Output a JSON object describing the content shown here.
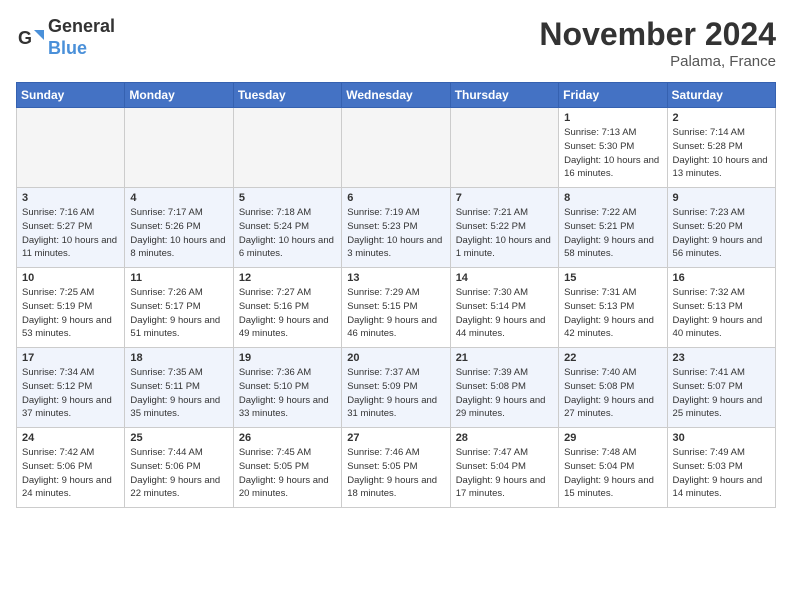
{
  "header": {
    "logo_line1": "General",
    "logo_line2": "Blue",
    "month": "November 2024",
    "location": "Palama, France"
  },
  "weekdays": [
    "Sunday",
    "Monday",
    "Tuesday",
    "Wednesday",
    "Thursday",
    "Friday",
    "Saturday"
  ],
  "weeks": [
    [
      {
        "day": "",
        "info": ""
      },
      {
        "day": "",
        "info": ""
      },
      {
        "day": "",
        "info": ""
      },
      {
        "day": "",
        "info": ""
      },
      {
        "day": "",
        "info": ""
      },
      {
        "day": "1",
        "info": "Sunrise: 7:13 AM\nSunset: 5:30 PM\nDaylight: 10 hours and 16 minutes."
      },
      {
        "day": "2",
        "info": "Sunrise: 7:14 AM\nSunset: 5:28 PM\nDaylight: 10 hours and 13 minutes."
      }
    ],
    [
      {
        "day": "3",
        "info": "Sunrise: 7:16 AM\nSunset: 5:27 PM\nDaylight: 10 hours and 11 minutes."
      },
      {
        "day": "4",
        "info": "Sunrise: 7:17 AM\nSunset: 5:26 PM\nDaylight: 10 hours and 8 minutes."
      },
      {
        "day": "5",
        "info": "Sunrise: 7:18 AM\nSunset: 5:24 PM\nDaylight: 10 hours and 6 minutes."
      },
      {
        "day": "6",
        "info": "Sunrise: 7:19 AM\nSunset: 5:23 PM\nDaylight: 10 hours and 3 minutes."
      },
      {
        "day": "7",
        "info": "Sunrise: 7:21 AM\nSunset: 5:22 PM\nDaylight: 10 hours and 1 minute."
      },
      {
        "day": "8",
        "info": "Sunrise: 7:22 AM\nSunset: 5:21 PM\nDaylight: 9 hours and 58 minutes."
      },
      {
        "day": "9",
        "info": "Sunrise: 7:23 AM\nSunset: 5:20 PM\nDaylight: 9 hours and 56 minutes."
      }
    ],
    [
      {
        "day": "10",
        "info": "Sunrise: 7:25 AM\nSunset: 5:19 PM\nDaylight: 9 hours and 53 minutes."
      },
      {
        "day": "11",
        "info": "Sunrise: 7:26 AM\nSunset: 5:17 PM\nDaylight: 9 hours and 51 minutes."
      },
      {
        "day": "12",
        "info": "Sunrise: 7:27 AM\nSunset: 5:16 PM\nDaylight: 9 hours and 49 minutes."
      },
      {
        "day": "13",
        "info": "Sunrise: 7:29 AM\nSunset: 5:15 PM\nDaylight: 9 hours and 46 minutes."
      },
      {
        "day": "14",
        "info": "Sunrise: 7:30 AM\nSunset: 5:14 PM\nDaylight: 9 hours and 44 minutes."
      },
      {
        "day": "15",
        "info": "Sunrise: 7:31 AM\nSunset: 5:13 PM\nDaylight: 9 hours and 42 minutes."
      },
      {
        "day": "16",
        "info": "Sunrise: 7:32 AM\nSunset: 5:13 PM\nDaylight: 9 hours and 40 minutes."
      }
    ],
    [
      {
        "day": "17",
        "info": "Sunrise: 7:34 AM\nSunset: 5:12 PM\nDaylight: 9 hours and 37 minutes."
      },
      {
        "day": "18",
        "info": "Sunrise: 7:35 AM\nSunset: 5:11 PM\nDaylight: 9 hours and 35 minutes."
      },
      {
        "day": "19",
        "info": "Sunrise: 7:36 AM\nSunset: 5:10 PM\nDaylight: 9 hours and 33 minutes."
      },
      {
        "day": "20",
        "info": "Sunrise: 7:37 AM\nSunset: 5:09 PM\nDaylight: 9 hours and 31 minutes."
      },
      {
        "day": "21",
        "info": "Sunrise: 7:39 AM\nSunset: 5:08 PM\nDaylight: 9 hours and 29 minutes."
      },
      {
        "day": "22",
        "info": "Sunrise: 7:40 AM\nSunset: 5:08 PM\nDaylight: 9 hours and 27 minutes."
      },
      {
        "day": "23",
        "info": "Sunrise: 7:41 AM\nSunset: 5:07 PM\nDaylight: 9 hours and 25 minutes."
      }
    ],
    [
      {
        "day": "24",
        "info": "Sunrise: 7:42 AM\nSunset: 5:06 PM\nDaylight: 9 hours and 24 minutes."
      },
      {
        "day": "25",
        "info": "Sunrise: 7:44 AM\nSunset: 5:06 PM\nDaylight: 9 hours and 22 minutes."
      },
      {
        "day": "26",
        "info": "Sunrise: 7:45 AM\nSunset: 5:05 PM\nDaylight: 9 hours and 20 minutes."
      },
      {
        "day": "27",
        "info": "Sunrise: 7:46 AM\nSunset: 5:05 PM\nDaylight: 9 hours and 18 minutes."
      },
      {
        "day": "28",
        "info": "Sunrise: 7:47 AM\nSunset: 5:04 PM\nDaylight: 9 hours and 17 minutes."
      },
      {
        "day": "29",
        "info": "Sunrise: 7:48 AM\nSunset: 5:04 PM\nDaylight: 9 hours and 15 minutes."
      },
      {
        "day": "30",
        "info": "Sunrise: 7:49 AM\nSunset: 5:03 PM\nDaylight: 9 hours and 14 minutes."
      }
    ]
  ]
}
